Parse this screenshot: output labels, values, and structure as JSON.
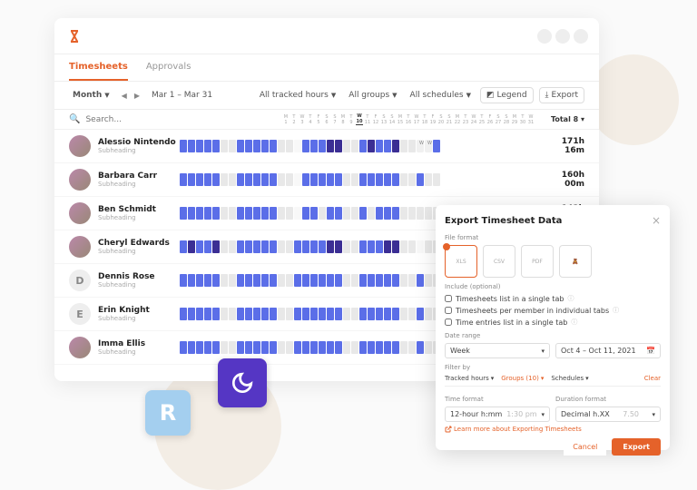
{
  "tabs": {
    "timesheets": "Timesheets",
    "approvals": "Approvals"
  },
  "filters": {
    "period": "Month",
    "paged": "Mar 1 – Mar 31",
    "hours": "All tracked hours",
    "groups": "All groups",
    "schedules": "All schedules",
    "legend": "Legend",
    "export": "Export"
  },
  "search": {
    "placeholder": "Search..."
  },
  "dayLetters": [
    "M",
    "T",
    "W",
    "T",
    "F",
    "S",
    "S",
    "M",
    "T",
    "W",
    "T",
    "F",
    "S",
    "S",
    "M",
    "T",
    "W",
    "T",
    "F",
    "S",
    "S",
    "M",
    "T",
    "W",
    "T",
    "F",
    "S",
    "S",
    "M",
    "T",
    "W"
  ],
  "dayNums": [
    "1",
    "2",
    "3",
    "4",
    "5",
    "6",
    "7",
    "8",
    "9",
    "10",
    "11",
    "12",
    "13",
    "14",
    "15",
    "16",
    "17",
    "18",
    "19",
    "20",
    "21",
    "22",
    "23",
    "24",
    "25",
    "26",
    "27",
    "28",
    "29",
    "30",
    "31"
  ],
  "totalHeader": "Total",
  "totalCount": "8",
  "users": [
    {
      "name": "Alessio Nintendo",
      "sub": "Subheading",
      "total": "171h 16m",
      "initial": ""
    },
    {
      "name": "Barbara Carr",
      "sub": "Subheading",
      "total": "160h 00m",
      "initial": ""
    },
    {
      "name": "Ben Schmidt",
      "sub": "Subheading",
      "total": "142h 00m",
      "initial": ""
    },
    {
      "name": "Cheryl Edwards",
      "sub": "Subheading",
      "total": "",
      "initial": ""
    },
    {
      "name": "Dennis Rose",
      "sub": "Subheading",
      "total": "",
      "initial": "D"
    },
    {
      "name": "Erin Knight",
      "sub": "Subheading",
      "total": "",
      "initial": "E"
    },
    {
      "name": "Imma Ellis",
      "sub": "Subheading",
      "total": "",
      "initial": ""
    }
  ],
  "patterns": [
    "BBBBBooBBBBBoobBBBDDooBDBBDooWWB",
    "BBBBBooBBBBBoobBBBBBooBBBBBooBoo",
    "BBBBBooBBBBBoobBBoBBooBoBBBooooo",
    "BDBBDooBBBBBooBBBBDDooBBBDDooboo",
    "BBBBBooBBBBBooBBBBBBooBBBBBooBoo",
    "BBBBBooBBBBBooBBBBBBooBBBBBooBoo",
    "BBBBBooBBBBBooBBBBBBooBBBBBooBoo"
  ],
  "modal": {
    "title": "Export Timesheet Data",
    "fileFormat": "File format",
    "formats": [
      "XLS",
      "CSV",
      "PDF",
      "qb"
    ],
    "includeLabel": "Include (optional)",
    "include1": "Timesheets list in a single tab",
    "include2": "Timesheets per member in individual tabs",
    "include3": "Time entries list in a single tab",
    "dateRange": "Date range",
    "week": "Week",
    "rangeVal": "Oct 4 – Oct 11, 2021",
    "filterBy": "Filter by",
    "trackedHours": "Tracked hours",
    "groupsN": "Groups (10)",
    "schedules": "Schedules",
    "clear": "Clear",
    "timeFormat": "Time format",
    "timeVal": "12-hour h:mm",
    "timeEx": "1:30 pm",
    "durFormat": "Duration format",
    "durVal": "Decimal h.XX",
    "durEx": "7.50",
    "learn": "Learn more about Exporting Timesheets",
    "cancel": "Cancel",
    "export": "Export"
  },
  "floats": {
    "r": "R"
  }
}
